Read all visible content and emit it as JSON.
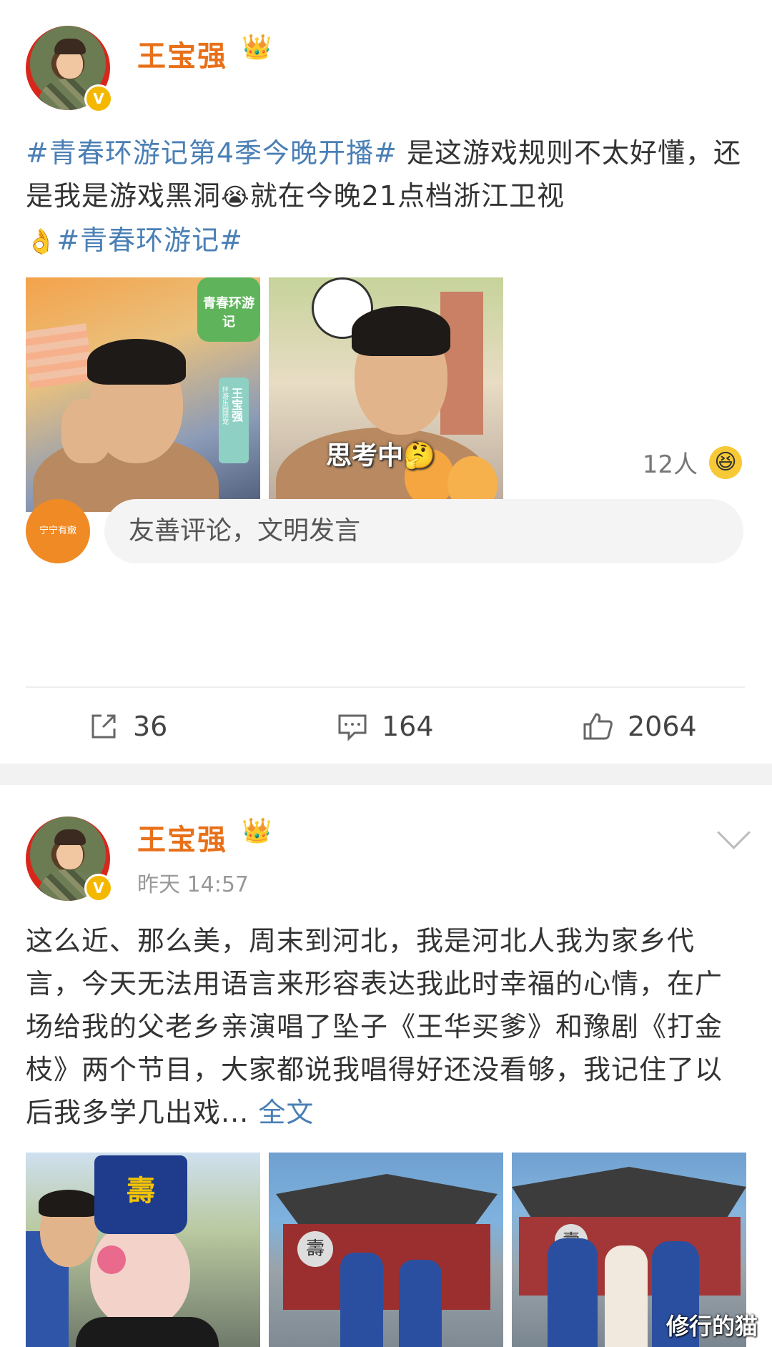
{
  "post1": {
    "username": "王宝强",
    "text_segments": {
      "hashtag1": "#青春环游记第4季今晚开播#",
      "body1": " 是这游戏规则不太好懂，还是我是游戏黑洞",
      "emoji1": "😭",
      "body2": "就在今晚21点档浙江卫视",
      "emoji2": "👌",
      "hashtag2": "#青春环游记#"
    },
    "images": [
      {
        "sticker": "青春环游记",
        "tag": "王宝强",
        "tag_small": "环游乐园团宠"
      },
      {
        "caption": "思考中🤔"
      }
    ],
    "reaction": {
      "count": "12人",
      "emoji": "😆"
    },
    "comment_box": {
      "placeholder": "友善评论，文明发言",
      "avatar_label": "宁宁有嫩"
    },
    "actions": {
      "repost": "36",
      "comment": "164",
      "like": "2064"
    }
  },
  "post2": {
    "username": "王宝强",
    "time": "昨天 14:57",
    "text": "这么近、那么美，周末到河北，我是河北人我为家乡代言，今天无法用语言来形容表达我此时幸福的心情，在广场给我的父老乡亲演唱了坠子《王华买爹》和豫剧《打金枝》两个节目，大家都说我唱得好还没看够，我记住了以后我多学几出戏...",
    "full_text_link": "全文",
    "images": [
      {
        "hat_mark": "壽"
      },
      {
        "stage_mark": "壽"
      },
      {
        "stage_mark": "壽"
      }
    ]
  },
  "watermark": "修行的猫",
  "colors": {
    "accent": "#e8701a",
    "link": "#4a7fb5",
    "separator": "#f2f2f2"
  }
}
